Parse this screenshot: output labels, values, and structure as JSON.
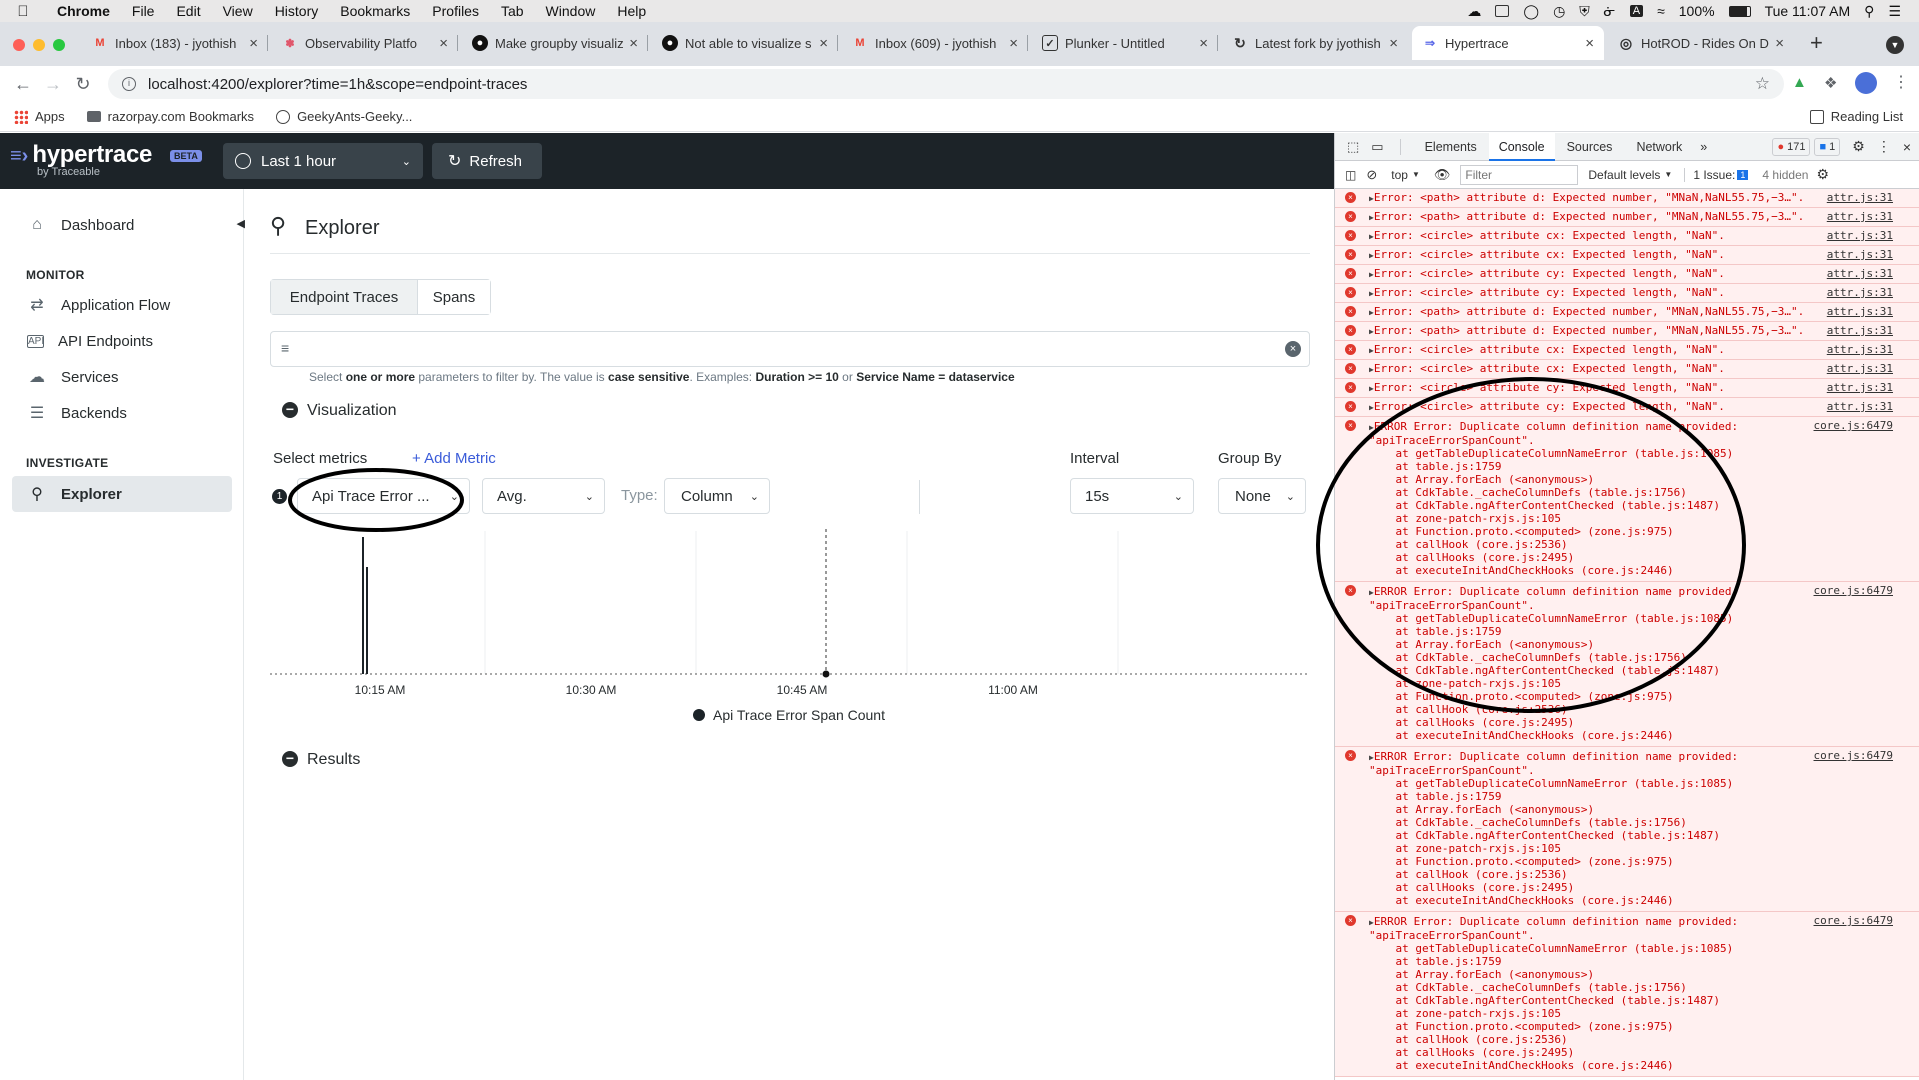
{
  "menubar": {
    "app": "Chrome",
    "items": [
      "File",
      "Edit",
      "View",
      "History",
      "Bookmarks",
      "Profiles",
      "Tab",
      "Window",
      "Help"
    ],
    "battery": "100%",
    "clock": "Tue 11:07 AM"
  },
  "tabs": [
    {
      "title": "Inbox (183) - jyothish",
      "icon": "gmail-icon"
    },
    {
      "title": "Observability Platfo",
      "icon": "observability-icon"
    },
    {
      "title": "Make groupby visualiz",
      "icon": "github-icon"
    },
    {
      "title": "Not able to visualize s",
      "icon": "github-icon"
    },
    {
      "title": "Inbox (609) - jyothish",
      "icon": "gmail-icon"
    },
    {
      "title": "Plunker - Untitled",
      "icon": "plunker-icon"
    },
    {
      "title": "Latest fork by jyothish",
      "icon": "fork-icon"
    },
    {
      "title": "Hypertrace",
      "icon": "hypertrace-icon"
    },
    {
      "title": "HotROD - Rides On De",
      "icon": "globe-icon"
    }
  ],
  "address": {
    "url": "localhost:4200/explorer?time=1h&scope=endpoint-traces"
  },
  "bookmarks": [
    "Apps",
    "razorpay.com Bookmarks",
    "GeekyAnts-Geeky..."
  ],
  "reading_list": "Reading List",
  "app": {
    "logo": "hypertrace",
    "beta": "BETA",
    "by": "by Traceable",
    "time_range": "Last 1 hour",
    "refresh": "Refresh"
  },
  "sidebar": {
    "dashboard": "Dashboard",
    "monitor_title": "MONITOR",
    "monitor": [
      "Application Flow",
      "API Endpoints",
      "Services",
      "Backends"
    ],
    "investigate_title": "INVESTIGATE",
    "explorer": "Explorer"
  },
  "explorer": {
    "title": "Explorer",
    "scope_tabs": [
      "Endpoint Traces",
      "Spans"
    ],
    "filter_hint_parts": [
      "Select ",
      "one or more",
      " parameters to filter by. The value is ",
      "case sensitive",
      ". Examples: ",
      "Duration >= 10",
      " or ",
      "Service Name = dataservice"
    ],
    "visualization": "Visualization",
    "select_metrics": "Select metrics",
    "add_metric": "+ Add Metric",
    "metric_index": "1",
    "metric": "Api Trace Error ...",
    "aggregation": "Avg.",
    "type_label": "Type:",
    "type": "Column",
    "interval_label": "Interval",
    "interval": "15s",
    "group_by_label": "Group By",
    "group_by": "None",
    "results": "Results"
  },
  "chart_data": {
    "type": "bar",
    "x_tick_labels": [
      "10:15 AM",
      "10:30 AM",
      "10:45 AM",
      "11:00 AM"
    ],
    "series": [
      {
        "name": "Api Trace Error Span Count",
        "color": "#1c2328"
      }
    ],
    "grid": "vertical"
  },
  "devtools": {
    "tabs": [
      "Elements",
      "Console",
      "Sources",
      "Network"
    ],
    "error_count": "171",
    "message_count": "1",
    "context": "top",
    "filter_placeholder": "Filter",
    "levels": "Default levels",
    "issues": "1 Issue: ",
    "issue_count": "1",
    "hidden": "4 hidden",
    "short_errors": [
      {
        "text": "Error: <path> attribute d: Expected number, \"MNaN,NaNL55.75,−3…\".",
        "src": "attr.js:31"
      },
      {
        "text": "Error: <path> attribute d: Expected number, \"MNaN,NaNL55.75,−3…\".",
        "src": "attr.js:31"
      },
      {
        "text": "Error: <circle> attribute cx: Expected length, \"NaN\".",
        "src": "attr.js:31"
      },
      {
        "text": "Error: <circle> attribute cx: Expected length, \"NaN\".",
        "src": "attr.js:31"
      },
      {
        "text": "Error: <circle> attribute cy: Expected length, \"NaN\".",
        "src": "attr.js:31"
      },
      {
        "text": "Error: <circle> attribute cy: Expected length, \"NaN\".",
        "src": "attr.js:31"
      },
      {
        "text": "Error: <path> attribute d: Expected number, \"MNaN,NaNL55.75,−3…\".",
        "src": "attr.js:31"
      },
      {
        "text": "Error: <path> attribute d: Expected number, \"MNaN,NaNL55.75,−3…\".",
        "src": "attr.js:31"
      },
      {
        "text": "Error: <circle> attribute cx: Expected length, \"NaN\".",
        "src": "attr.js:31"
      },
      {
        "text": "Error: <circle> attribute cx: Expected length, \"NaN\".",
        "src": "attr.js:31"
      },
      {
        "text": "Error: <circle> attribute cy: Expected length, \"NaN\".",
        "src": "attr.js:31"
      },
      {
        "text": "Error: <circle> attribute cy: Expected length, \"NaN\".",
        "src": "attr.js:31"
      }
    ],
    "long_error": {
      "header": "ERROR Error: Duplicate column definition name provided:",
      "detail": "\"apiTraceErrorSpanCount\".",
      "src": "core.js:6479",
      "stack": [
        "    at getTableDuplicateColumnNameError (table.js:1085)",
        "    at table.js:1759",
        "    at Array.forEach (<anonymous>)",
        "    at CdkTable._cacheColumnDefs (table.js:1756)",
        "    at CdkTable.ngAfterContentChecked (table.js:1487)",
        "    at zone-patch-rxjs.js:105",
        "    at Function.proto.<computed> (zone.js:975)",
        "    at callHook (core.js:2536)",
        "    at callHooks (core.js:2495)",
        "    at executeInitAndCheckHooks (core.js:2446)"
      ]
    },
    "long_error_repeats": 4
  }
}
